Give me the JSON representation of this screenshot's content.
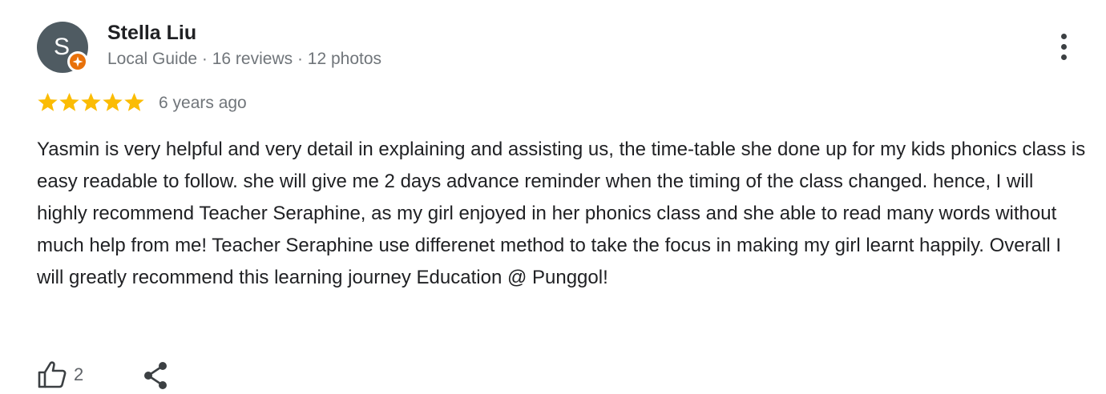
{
  "reviewer": {
    "initial": "S",
    "name": "Stella Liu",
    "meta": "Local Guide · 16 reviews · 12 photos",
    "avatar_color": "#4f5b62",
    "badge_color": "#e8710a",
    "badge_icon": "local-guide-star-icon"
  },
  "rating": {
    "stars": 5,
    "max": 5,
    "star_color": "#fbbc04",
    "time": "6 years ago"
  },
  "review": {
    "text": "Yasmin is very helpful and very detail in explaining and assisting us, the time-table she done up for my kids phonics class is easy readable to follow. she will give me 2 days advance reminder when the timing of the class changed. hence, I will highly recommend Teacher Seraphine, as my girl enjoyed in her phonics class and she able to read many words without much help from me! Teacher Seraphine use differenet method to take the focus in making my girl learnt happily. Overall I will greatly recommend this learning journey Education @ Punggol!"
  },
  "actions": {
    "like_icon": "thumbs-up-icon",
    "like_count": "2",
    "share_icon": "share-icon",
    "more_icon": "more-vert-icon"
  }
}
